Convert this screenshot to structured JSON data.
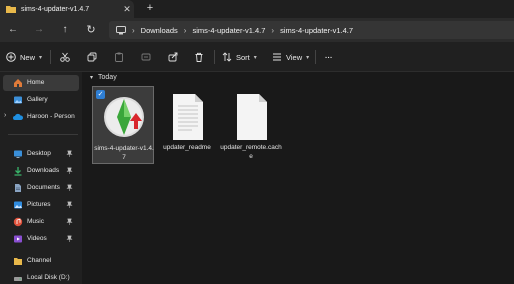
{
  "tab": {
    "title": "sims-4-updater-v1.4.7",
    "close": "✕",
    "new_tab": "+"
  },
  "address": {
    "crumbs": [
      "Downloads",
      "sims-4-updater-v1.4.7",
      "sims-4-updater-v1.4.7"
    ],
    "separator": "›"
  },
  "toolbar": {
    "new_label": "New",
    "sort_label": "Sort",
    "view_label": "View",
    "more_label": "···"
  },
  "sidebar": {
    "items": [
      {
        "label": "Home",
        "icon": "home-icon"
      },
      {
        "label": "Gallery",
        "icon": "gallery-icon"
      },
      {
        "label": "Haroon - Person",
        "icon": "onedrive-icon"
      },
      {
        "label": "Desktop",
        "icon": "desktop-icon"
      },
      {
        "label": "Downloads",
        "icon": "downloads-icon"
      },
      {
        "label": "Documents",
        "icon": "documents-icon"
      },
      {
        "label": "Pictures",
        "icon": "pictures-icon"
      },
      {
        "label": "Music",
        "icon": "music-icon"
      },
      {
        "label": "Videos",
        "icon": "videos-icon"
      },
      {
        "label": "Channel",
        "icon": "folder-icon"
      },
      {
        "label": "Local Disk (D:)",
        "icon": "drive-icon"
      }
    ]
  },
  "content": {
    "group": "Today",
    "files": [
      {
        "name": "sims-4-updater-v1.4.7",
        "icon": "sims-app-icon",
        "selected": true
      },
      {
        "name": "updater_readme",
        "icon": "document-icon",
        "selected": false
      },
      {
        "name": "updater_remote.cache",
        "icon": "document-icon",
        "selected": false
      }
    ]
  },
  "colors": {
    "accent": "#2f7fd4",
    "folder": "#e8b84a",
    "background": "#191919"
  }
}
